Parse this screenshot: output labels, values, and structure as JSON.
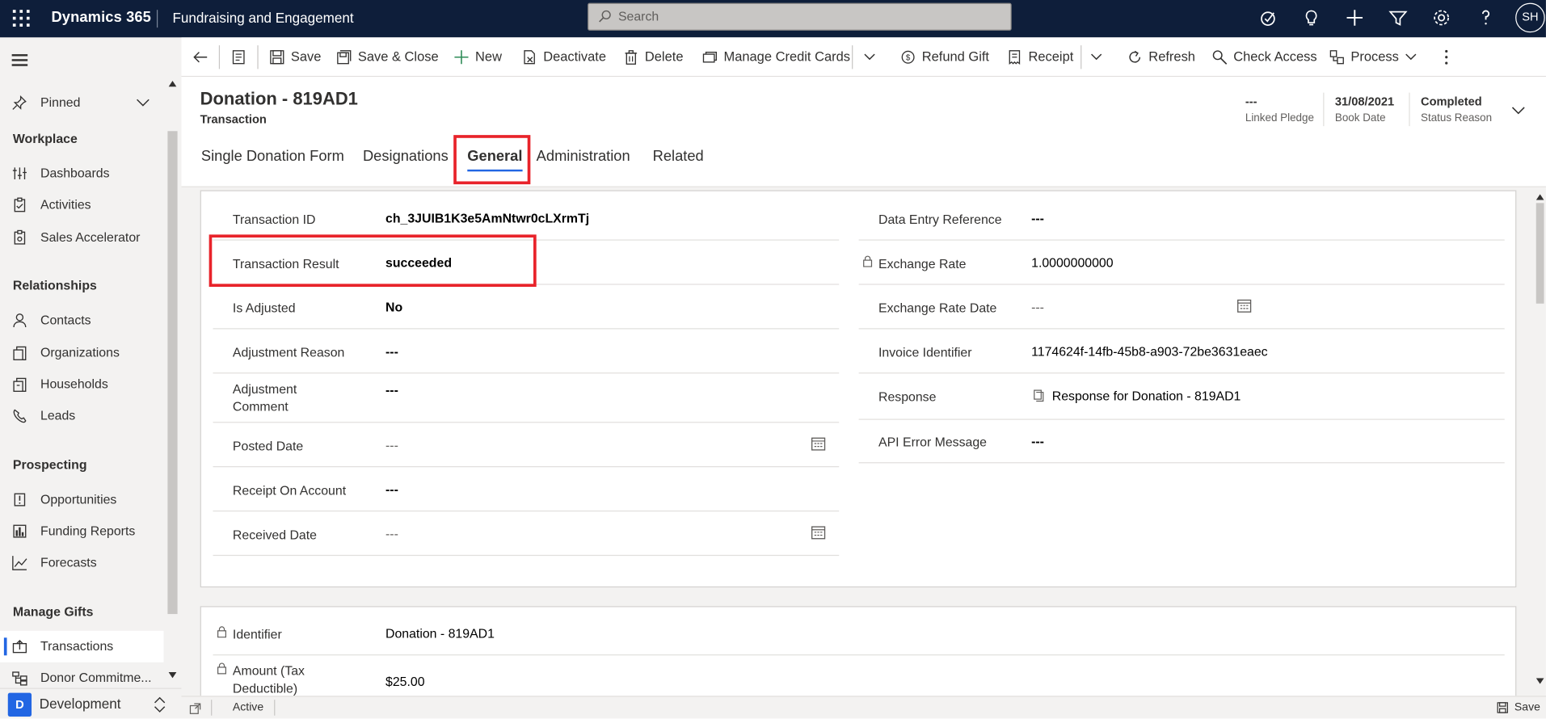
{
  "topbar": {
    "brand": "Dynamics 365",
    "app_name": "Fundraising and Engagement",
    "search_placeholder": "Search",
    "user_initials": "SH"
  },
  "nav": {
    "pinned": "Pinned",
    "sections": [
      {
        "title": "Workplace",
        "items": [
          "Dashboards",
          "Activities",
          "Sales Accelerator"
        ]
      },
      {
        "title": "Relationships",
        "items": [
          "Contacts",
          "Organizations",
          "Households",
          "Leads"
        ]
      },
      {
        "title": "Prospecting",
        "items": [
          "Opportunities",
          "Funding Reports",
          "Forecasts"
        ]
      },
      {
        "title": "Manage Gifts",
        "items": [
          "Transactions",
          "Donor Commitme..."
        ]
      }
    ],
    "selected_item": "Transactions",
    "environment_initial": "D",
    "environment": "Development"
  },
  "commands": {
    "save": "Save",
    "save_close": "Save & Close",
    "new": "New",
    "deactivate": "Deactivate",
    "delete": "Delete",
    "manage_credit_cards": "Manage Credit Cards",
    "refund_gift": "Refund Gift",
    "receipt": "Receipt",
    "refresh": "Refresh",
    "check_access": "Check Access",
    "process": "Process"
  },
  "form": {
    "title": "Donation - 819AD1",
    "entity": "Transaction",
    "header_fields": [
      {
        "value": "---",
        "label": "Linked Pledge"
      },
      {
        "value": "31/08/2021",
        "label": "Book Date"
      },
      {
        "value": "Completed",
        "label": "Status Reason"
      }
    ],
    "tabs": [
      "Single Donation Form",
      "Designations",
      "General",
      "Administration",
      "Related"
    ],
    "active_tab": "General"
  },
  "general_left": [
    {
      "label": "Transaction ID",
      "value": "ch_3JUIB1K3e5AmNtwr0cLXrmTj"
    },
    {
      "label": "Transaction Result",
      "value": "succeeded"
    },
    {
      "label": "Is Adjusted",
      "value": "No"
    },
    {
      "label": "Adjustment Reason",
      "value": "---"
    },
    {
      "label": "Adjustment Comment",
      "value": "---"
    },
    {
      "label": "Posted Date",
      "value": "---"
    },
    {
      "label": "Receipt On Account",
      "value": "---"
    },
    {
      "label": "Received Date",
      "value": "---"
    }
  ],
  "general_right": [
    {
      "label": "Data Entry Reference",
      "value": "---"
    },
    {
      "label": "Exchange Rate",
      "value": "1.0000000000"
    },
    {
      "label": "Exchange Rate Date",
      "value": "---"
    },
    {
      "label": "Invoice Identifier",
      "value": "1174624f-14fb-45b8-a903-72be3631eaec"
    },
    {
      "label": "Response",
      "value": "Response for Donation - 819AD1"
    },
    {
      "label": "API Error Message",
      "value": "---"
    }
  ],
  "second_section": [
    {
      "label": "Identifier",
      "value": "Donation - 819AD1"
    },
    {
      "label": "Amount (Tax Deductible)",
      "value": "$25.00"
    }
  ],
  "status": {
    "state": "Active",
    "save": "Save"
  },
  "colors": {
    "topbar": "#0e1e3a",
    "accent": "#2266e3",
    "highlight": "#e8232a",
    "link": "#115ea3"
  }
}
